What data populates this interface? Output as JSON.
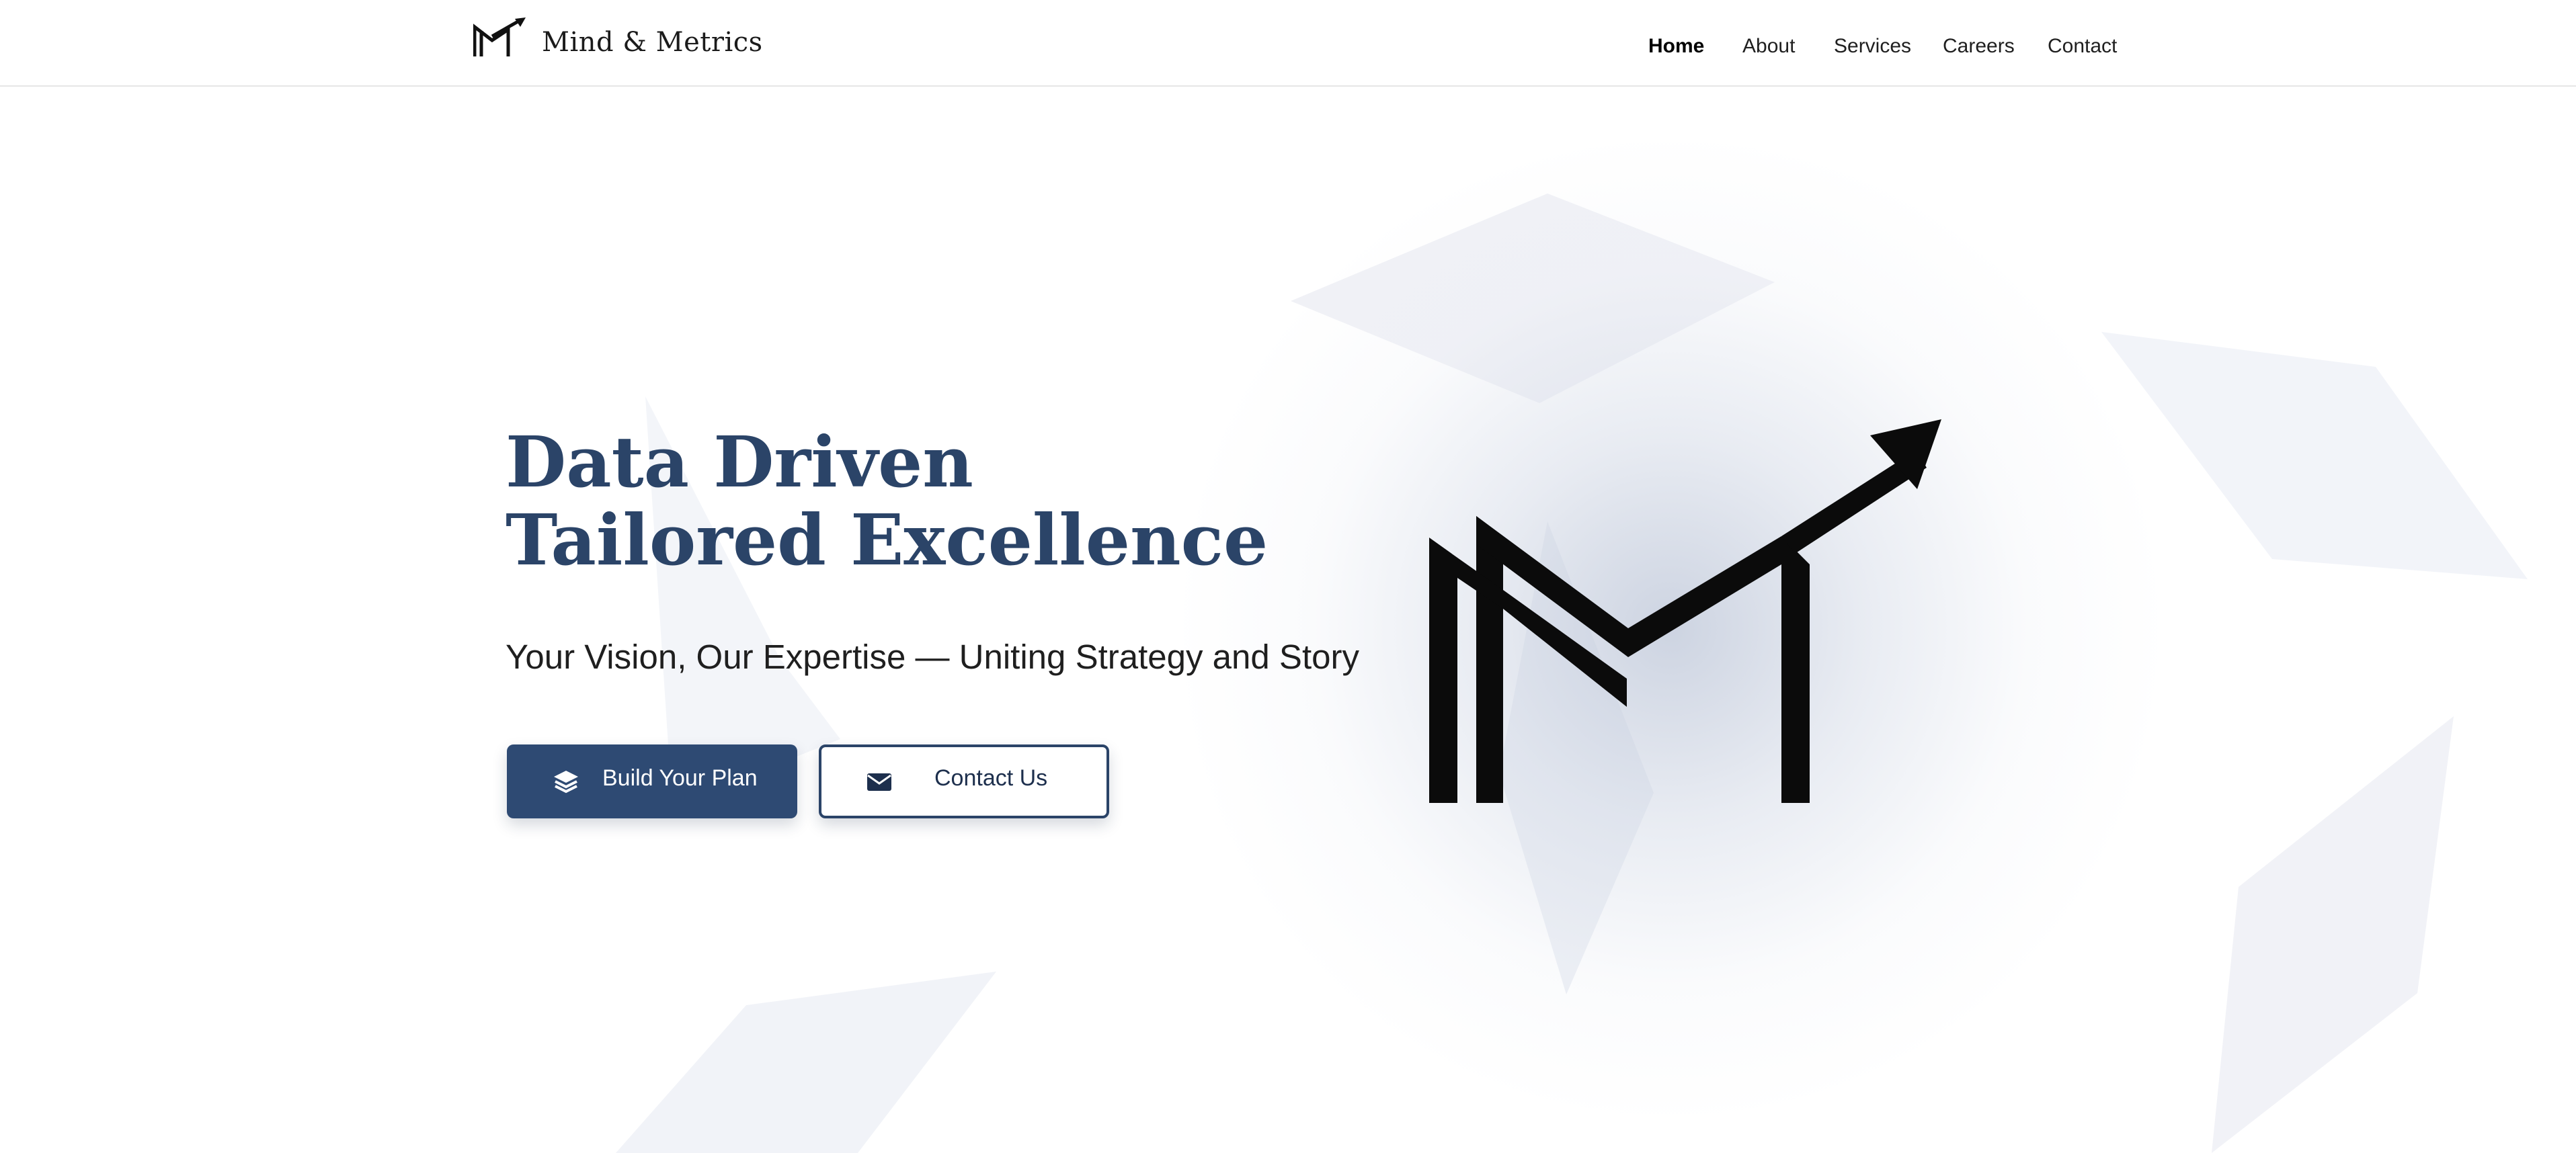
{
  "header": {
    "logo_icon": "mm-arrow-logo-icon",
    "brand_name": "Mind & Metrics",
    "nav": [
      {
        "label": "Home",
        "active": true
      },
      {
        "label": "About",
        "active": false
      },
      {
        "label": "Services",
        "active": false
      },
      {
        "label": "Careers",
        "active": false
      },
      {
        "label": "Contact",
        "active": false
      }
    ]
  },
  "hero": {
    "title_line1": "Data Driven",
    "title_line2": "Tailored Excellence",
    "subtitle": "Your Vision, Our Expertise — Uniting Strategy and Story",
    "primary_button": {
      "label": "Build Your Plan",
      "icon": "layers-icon"
    },
    "secondary_button": {
      "label": "Contact Us",
      "icon": "envelope-icon"
    },
    "illustration_icon": "mm-arrow-logo-icon"
  },
  "colors": {
    "brand_navy": "#2b4468",
    "button_fill": "#2e4a73",
    "text_dark": "#1f1f1f"
  }
}
